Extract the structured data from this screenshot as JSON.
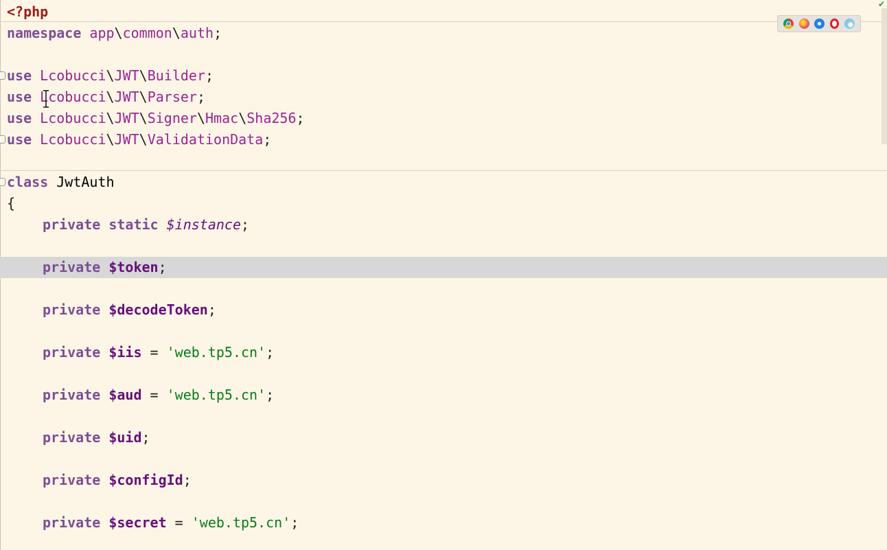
{
  "editor": {
    "language": "PHP",
    "highlighted_line": 12
  },
  "lines": [
    {
      "tokens": [
        {
          "t": "<?php",
          "c": "tag"
        }
      ]
    },
    {
      "tokens": [
        {
          "t": "namespace",
          "c": "kw"
        },
        {
          "t": " ",
          "c": "punc"
        },
        {
          "t": "app",
          "c": "ns"
        },
        {
          "t": "\\",
          "c": "punc"
        },
        {
          "t": "common",
          "c": "ns"
        },
        {
          "t": "\\",
          "c": "punc"
        },
        {
          "t": "auth",
          "c": "ns"
        },
        {
          "t": ";",
          "c": "punc"
        }
      ]
    },
    {
      "tokens": []
    },
    {
      "tokens": [
        {
          "t": "use",
          "c": "kw"
        },
        {
          "t": " ",
          "c": "punc"
        },
        {
          "t": "Lcobucci",
          "c": "ns"
        },
        {
          "t": "\\",
          "c": "punc"
        },
        {
          "t": "JWT",
          "c": "ns"
        },
        {
          "t": "\\",
          "c": "punc"
        },
        {
          "t": "Builder",
          "c": "ns"
        },
        {
          "t": ";",
          "c": "punc"
        }
      ]
    },
    {
      "tokens": [
        {
          "t": "use",
          "c": "kw"
        },
        {
          "t": " ",
          "c": "punc"
        },
        {
          "t": "Lcobucci",
          "c": "ns"
        },
        {
          "t": "\\",
          "c": "punc"
        },
        {
          "t": "JWT",
          "c": "ns"
        },
        {
          "t": "\\",
          "c": "punc"
        },
        {
          "t": "Parser",
          "c": "ns"
        },
        {
          "t": ";",
          "c": "punc"
        }
      ]
    },
    {
      "tokens": [
        {
          "t": "use",
          "c": "kw"
        },
        {
          "t": " ",
          "c": "punc"
        },
        {
          "t": "Lcobucci",
          "c": "ns"
        },
        {
          "t": "\\",
          "c": "punc"
        },
        {
          "t": "JWT",
          "c": "ns"
        },
        {
          "t": "\\",
          "c": "punc"
        },
        {
          "t": "Signer",
          "c": "ns"
        },
        {
          "t": "\\",
          "c": "punc"
        },
        {
          "t": "Hmac",
          "c": "ns"
        },
        {
          "t": "\\",
          "c": "punc"
        },
        {
          "t": "Sha256",
          "c": "ns"
        },
        {
          "t": ";",
          "c": "punc"
        }
      ]
    },
    {
      "tokens": [
        {
          "t": "use",
          "c": "kw"
        },
        {
          "t": " ",
          "c": "punc"
        },
        {
          "t": "Lcobucci",
          "c": "ns"
        },
        {
          "t": "\\",
          "c": "punc"
        },
        {
          "t": "JWT",
          "c": "ns"
        },
        {
          "t": "\\",
          "c": "punc"
        },
        {
          "t": "ValidationData",
          "c": "ns"
        },
        {
          "t": ";",
          "c": "punc"
        }
      ]
    },
    {
      "tokens": []
    },
    {
      "tokens": [
        {
          "t": "class",
          "c": "kw"
        },
        {
          "t": " ",
          "c": "punc"
        },
        {
          "t": "JwtAuth",
          "c": "cls"
        }
      ]
    },
    {
      "tokens": [
        {
          "t": "{",
          "c": "punc"
        }
      ]
    },
    {
      "indent": 1,
      "tokens": [
        {
          "t": "private",
          "c": "kw"
        },
        {
          "t": " ",
          "c": "punc"
        },
        {
          "t": "static",
          "c": "kw"
        },
        {
          "t": " ",
          "c": "punc"
        },
        {
          "t": "$instance",
          "c": "ivar"
        },
        {
          "t": ";",
          "c": "punc"
        }
      ]
    },
    {
      "tokens": []
    },
    {
      "indent": 1,
      "tokens": [
        {
          "t": "private",
          "c": "kw"
        },
        {
          "t": " ",
          "c": "punc"
        },
        {
          "t": "$token",
          "c": "var"
        },
        {
          "t": ";",
          "c": "punc"
        }
      ]
    },
    {
      "tokens": []
    },
    {
      "indent": 1,
      "tokens": [
        {
          "t": "private",
          "c": "kw"
        },
        {
          "t": " ",
          "c": "punc"
        },
        {
          "t": "$decodeToken",
          "c": "var"
        },
        {
          "t": ";",
          "c": "punc"
        }
      ]
    },
    {
      "tokens": []
    },
    {
      "indent": 1,
      "tokens": [
        {
          "t": "private",
          "c": "kw"
        },
        {
          "t": " ",
          "c": "punc"
        },
        {
          "t": "$iis",
          "c": "var"
        },
        {
          "t": " = ",
          "c": "punc"
        },
        {
          "t": "'web.tp5.cn'",
          "c": "str"
        },
        {
          "t": ";",
          "c": "punc"
        }
      ]
    },
    {
      "tokens": []
    },
    {
      "indent": 1,
      "tokens": [
        {
          "t": "private",
          "c": "kw"
        },
        {
          "t": " ",
          "c": "punc"
        },
        {
          "t": "$aud",
          "c": "var"
        },
        {
          "t": " = ",
          "c": "punc"
        },
        {
          "t": "'web.tp5.cn'",
          "c": "str"
        },
        {
          "t": ";",
          "c": "punc"
        }
      ]
    },
    {
      "tokens": []
    },
    {
      "indent": 1,
      "tokens": [
        {
          "t": "private",
          "c": "kw"
        },
        {
          "t": " ",
          "c": "punc"
        },
        {
          "t": "$uid",
          "c": "var"
        },
        {
          "t": ";",
          "c": "punc"
        }
      ]
    },
    {
      "tokens": []
    },
    {
      "indent": 1,
      "tokens": [
        {
          "t": "private",
          "c": "kw"
        },
        {
          "t": " ",
          "c": "punc"
        },
        {
          "t": "$configId",
          "c": "var"
        },
        {
          "t": ";",
          "c": "punc"
        }
      ]
    },
    {
      "tokens": []
    },
    {
      "indent": 1,
      "tokens": [
        {
          "t": "private",
          "c": "kw"
        },
        {
          "t": " ",
          "c": "punc"
        },
        {
          "t": "$secret",
          "c": "var"
        },
        {
          "t": " = ",
          "c": "punc"
        },
        {
          "t": "'web.tp5.cn'",
          "c": "str"
        },
        {
          "t": ";",
          "c": "punc"
        }
      ]
    }
  ],
  "browser_icons": [
    "chrome-icon",
    "firefox-icon",
    "safari-icon",
    "opera-icon",
    "edge-icon"
  ],
  "status": {
    "inspection_icon": "check-icon"
  },
  "colors": {
    "background": "#fdf6e7",
    "highlight": "#d7d7d7",
    "keyword": "#7c4d94",
    "namespace": "#9b2393",
    "variable": "#660e7a",
    "string": "#067d17",
    "php_tag": "#9e1a14"
  }
}
